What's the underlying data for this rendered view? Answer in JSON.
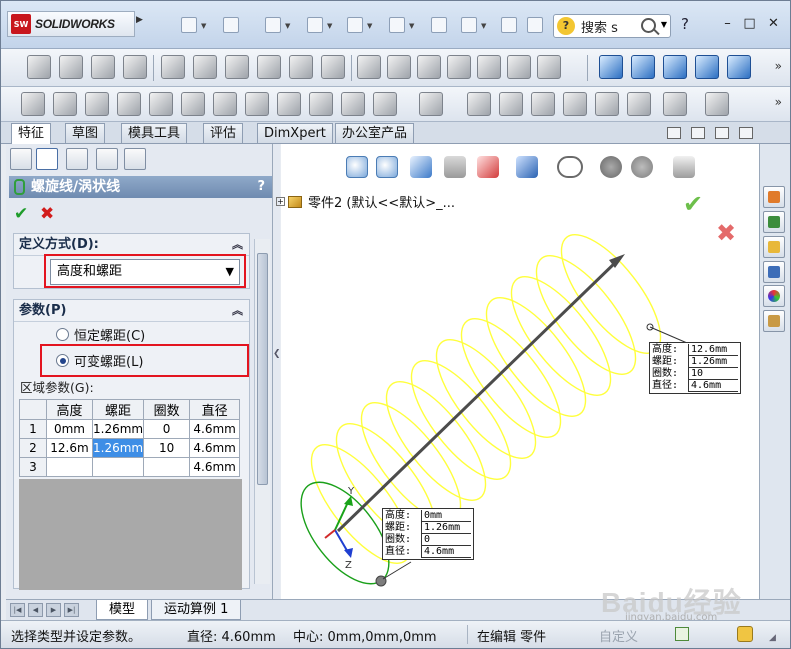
{
  "app": {
    "brand": "SOLIDWORKS",
    "search_label": "搜索 s",
    "help": "?",
    "window_controls": [
      "–",
      "□",
      "✕"
    ]
  },
  "command_tabs": [
    "特征",
    "草图",
    "模具工具",
    "评估",
    "DimXpert",
    "办公室产品"
  ],
  "property_manager": {
    "title": "螺旋线/涡状线",
    "help": "?",
    "ok": "✔",
    "cancel": "✖",
    "definition_group": {
      "label": "定义方式(D):",
      "selected": "高度和螺距"
    },
    "parameters_group": {
      "label": "参数(P)",
      "options": [
        {
          "label": "恒定螺距(C)",
          "checked": false
        },
        {
          "label": "可变螺距(L)",
          "checked": true
        }
      ]
    },
    "region_label": "区域参数(G):",
    "table": {
      "headers": [
        "",
        "高度",
        "螺距",
        "圈数",
        "直径"
      ],
      "rows": [
        [
          "1",
          "0mm",
          "1.26mm",
          "0",
          "4.6mm"
        ],
        [
          "2",
          "12.6m",
          "1.26mm",
          "10",
          "4.6mm"
        ],
        [
          "3",
          "",
          "",
          "",
          "4.6mm"
        ]
      ]
    }
  },
  "graphics": {
    "tree_node": "零件2 (默认<<默认>_...",
    "callout_top": [
      {
        "k": "高度:",
        "v": "12.6mm"
      },
      {
        "k": "螺距:",
        "v": "1.26mm"
      },
      {
        "k": "圈数:",
        "v": "10"
      },
      {
        "k": "直径:",
        "v": "4.6mm"
      }
    ],
    "callout_bottom": [
      {
        "k": "高度:",
        "v": "0mm"
      },
      {
        "k": "螺距:",
        "v": "1.26mm"
      },
      {
        "k": "圈数:",
        "v": "0"
      },
      {
        "k": "直径:",
        "v": "4.6mm"
      }
    ],
    "axis_labels": {
      "y": "Y",
      "z": "Z"
    },
    "colors": {
      "helix": "#ffff3c",
      "start_ring": "#1aa01a",
      "axis": "#4c4c4c",
      "confirm": "#6dbf4b",
      "reject": "#e46a6a"
    }
  },
  "bottom_tabs": [
    "模型",
    "运动算例 1"
  ],
  "status": {
    "message": "选择类型并设定参数。",
    "diameter": "直径: 4.60mm",
    "center": "中心: 0mm,0mm,0mm",
    "mode": "在编辑 零件",
    "custom": "自定义"
  },
  "watermark": {
    "main": "Baidu经验",
    "sub": "jingyan.baidu.com"
  }
}
